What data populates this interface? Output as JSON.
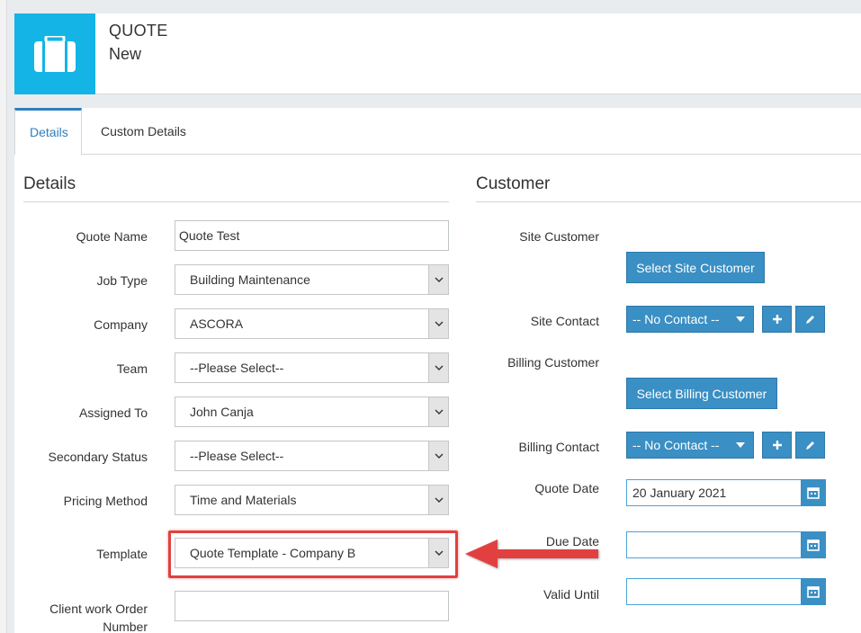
{
  "header": {
    "title": "QUOTE",
    "subtitle": "New",
    "icon": "briefcase-icon",
    "accent_color": "#14b4e6"
  },
  "tabs": [
    {
      "label": "Details",
      "active": true
    },
    {
      "label": "Custom Details",
      "active": false
    }
  ],
  "details": {
    "section_title": "Details",
    "quote_name": {
      "label": "Quote Name",
      "value": "Quote Test"
    },
    "job_type": {
      "label": "Job Type",
      "value": "Building Maintenance"
    },
    "company": {
      "label": "Company",
      "value": "ASCORA"
    },
    "team": {
      "label": "Team",
      "value": "--Please Select--"
    },
    "assigned_to": {
      "label": "Assigned To",
      "value": "John Canja"
    },
    "secondary_status": {
      "label": "Secondary Status",
      "value": "--Please Select--"
    },
    "pricing_method": {
      "label": "Pricing Method",
      "value": "Time and Materials"
    },
    "template": {
      "label": "Template",
      "value": "Quote Template - Company B"
    },
    "client_work_order": {
      "label_line1": "Client work Order",
      "label_line2": "Number",
      "value": ""
    }
  },
  "customer": {
    "section_title": "Customer",
    "site_customer_label": "Site Customer",
    "select_site_customer": "Select Site Customer",
    "site_contact_label": "Site Contact",
    "site_contact_value": "-- No Contact --",
    "billing_customer_label": "Billing Customer",
    "select_billing_customer": "Select Billing Customer",
    "billing_contact_label": "Billing Contact",
    "billing_contact_value": "-- No Contact --",
    "quote_date_label": "Quote Date",
    "quote_date_value": "20 January 2021",
    "due_date_label": "Due Date",
    "due_date_value": "",
    "valid_until_label": "Valid Until",
    "valid_until_value": ""
  },
  "colors": {
    "button_blue": "#3a8fc4",
    "highlight_red": "#e24040",
    "active_tab": "#2d7fbf"
  }
}
